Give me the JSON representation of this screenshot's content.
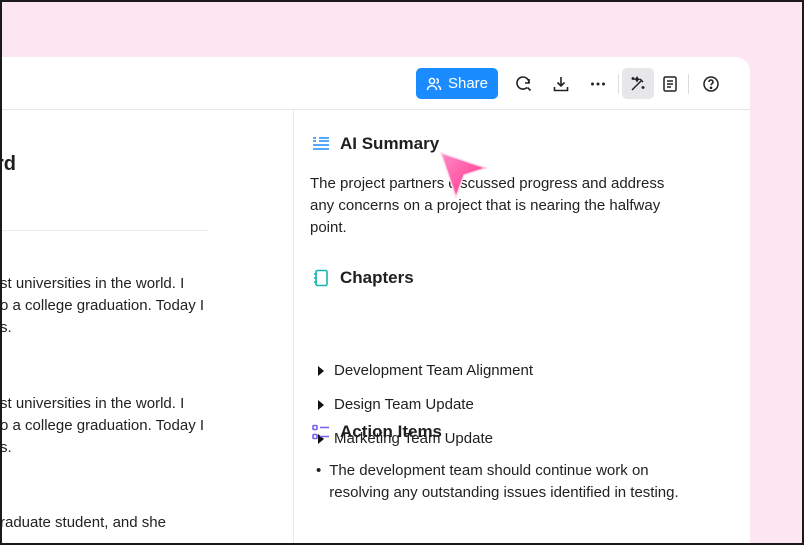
{
  "toolbar": {
    "share_label": "Share",
    "icons": [
      "refresh-search-icon",
      "download-icon",
      "more-icon",
      "magic-wand-icon",
      "notes-icon",
      "help-icon"
    ]
  },
  "left": {
    "title_fragment": "rd",
    "paragraphs": [
      "st universities in the world. I\no a college graduation. Today I\ns.",
      "st universities in the world. I\no a college graduation. Today I\ns.",
      "raduate student, and she"
    ]
  },
  "summary": {
    "heading": "AI Summary",
    "text": "The project partners discussed progress and address any concerns on a project that is nearing the halfway point."
  },
  "chapters": {
    "heading": "Chapters",
    "items": [
      "Development Team Alignment",
      "Design Team Update",
      "Marketing Team Update"
    ]
  },
  "actions": {
    "heading": "Action Items",
    "bullet": "•",
    "items": [
      "The development team should continue work on resolving any outstanding issues identified in testing."
    ]
  },
  "colors": {
    "accent": "#1a8cff",
    "background": "#fde6f1",
    "cursor": "#ff3d95"
  }
}
